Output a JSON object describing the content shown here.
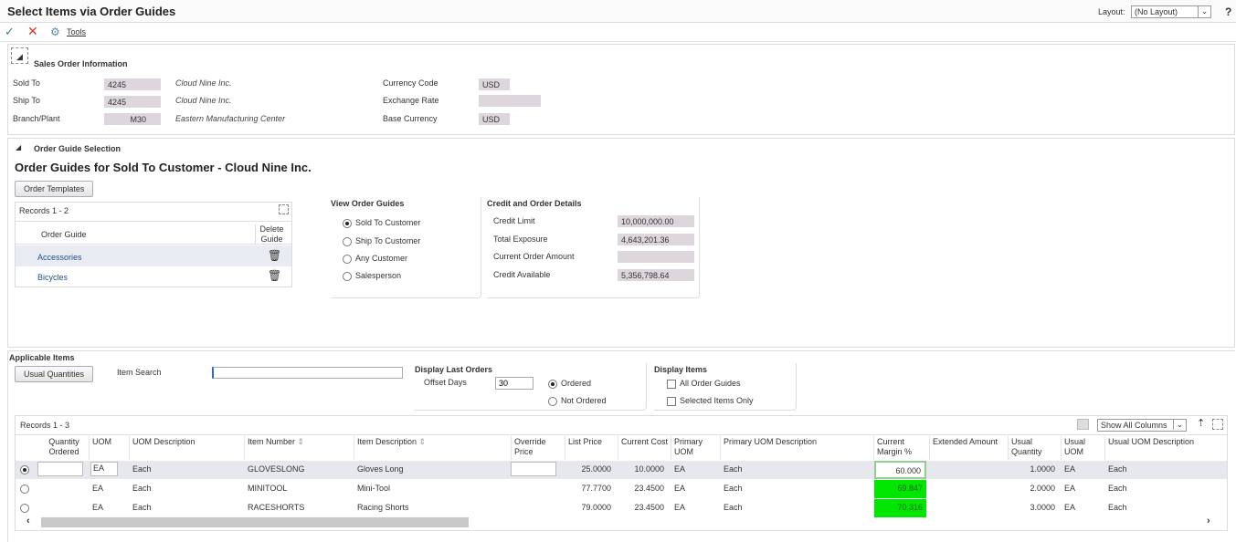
{
  "title": "Select Items via Order Guides",
  "layout": {
    "label": "Layout:",
    "value": "(No Layout)"
  },
  "help": "?",
  "toolbar": {
    "tools": "Tools"
  },
  "sales_order": {
    "header": "Sales Order Information",
    "sold_to": {
      "label": "Sold To",
      "value": "4245",
      "name": "Cloud Nine Inc."
    },
    "ship_to": {
      "label": "Ship To",
      "value": "4245",
      "name": "Cloud Nine Inc."
    },
    "branch": {
      "label": "Branch/Plant",
      "value": "M30",
      "name": "Eastern Manufacturing Center"
    },
    "currency_code": {
      "label": "Currency Code",
      "value": "USD"
    },
    "exchange_rate": {
      "label": "Exchange Rate",
      "value": ""
    },
    "base_currency": {
      "label": "Base Currency",
      "value": "USD"
    }
  },
  "order_guide": {
    "header": "Order Guide Selection",
    "title": "Order Guides for Sold To Customer - Cloud Nine Inc.",
    "templates_btn": "Order Templates",
    "records": "Records 1 - 2",
    "cols": [
      "Order Guide",
      "Delete Guide"
    ],
    "rows": [
      "Accessories",
      "Bicycles"
    ],
    "view": {
      "title": "View Order Guides",
      "options": [
        "Sold To Customer",
        "Ship To Customer",
        "Any Customer",
        "Salesperson"
      ]
    },
    "credit": {
      "title": "Credit and Order Details",
      "rows": [
        {
          "label": "Credit Limit",
          "value": "10,000,000.00"
        },
        {
          "label": "Total Exposure",
          "value": "4,643,201.36"
        },
        {
          "label": "Current Order Amount",
          "value": ""
        },
        {
          "label": "Credit Available",
          "value": "5,356,798.64"
        }
      ]
    }
  },
  "applicable": {
    "header": "Applicable Items",
    "usual_btn": "Usual Quantities",
    "item_search": "Item Search",
    "item_search_value": "",
    "last_orders": {
      "title": "Display Last Orders",
      "offset_label": "Offset Days",
      "offset_value": "30",
      "ordered": "Ordered",
      "not_ordered": "Not Ordered"
    },
    "display_items": {
      "title": "Display Items",
      "all": "All Order Guides",
      "selected": "Selected Items Only"
    }
  },
  "grid": {
    "records": "Records 1 - 3",
    "show_columns": "Show All Columns",
    "cols": [
      "Quantity Ordered",
      "UOM",
      "UOM Description",
      "Item Number",
      "Item Description",
      "Override Price",
      "List Price",
      "Current Cost",
      "Primary UOM",
      "Primary UOM Description",
      "Current Margin %",
      "Extended Amount",
      "Usual Quantity",
      "Usual UOM",
      "Usual UOM Description"
    ],
    "rows": [
      {
        "qty": "",
        "uom": "EA",
        "uomd": "Each",
        "item": "GLOVESLONG",
        "desc": "Gloves Long",
        "ovr": "",
        "list": "25.0000",
        "cost": "10.0000",
        "puom": "EA",
        "puomd": "Each",
        "margin": "60.000",
        "ext": "",
        "uq": "1.0000",
        "uu": "EA",
        "uud": "Each"
      },
      {
        "qty": "",
        "uom": "EA",
        "uomd": "Each",
        "item": "MINITOOL",
        "desc": "Mini-Tool",
        "ovr": "",
        "list": "77.7700",
        "cost": "23.4500",
        "puom": "EA",
        "puomd": "Each",
        "margin": "69.847",
        "ext": "",
        "uq": "2.0000",
        "uu": "EA",
        "uud": "Each"
      },
      {
        "qty": "",
        "uom": "EA",
        "uomd": "Each",
        "item": "RACESHORTS",
        "desc": "Racing Shorts",
        "ovr": "",
        "list": "79.0000",
        "cost": "23.4500",
        "puom": "EA",
        "puomd": "Each",
        "margin": "70.316",
        "ext": "",
        "uq": "3.0000",
        "uu": "EA",
        "uud": "Each"
      }
    ]
  },
  "colors": {
    "margin_highlight": "#00e600",
    "field_bg": "#ddd6dd"
  }
}
